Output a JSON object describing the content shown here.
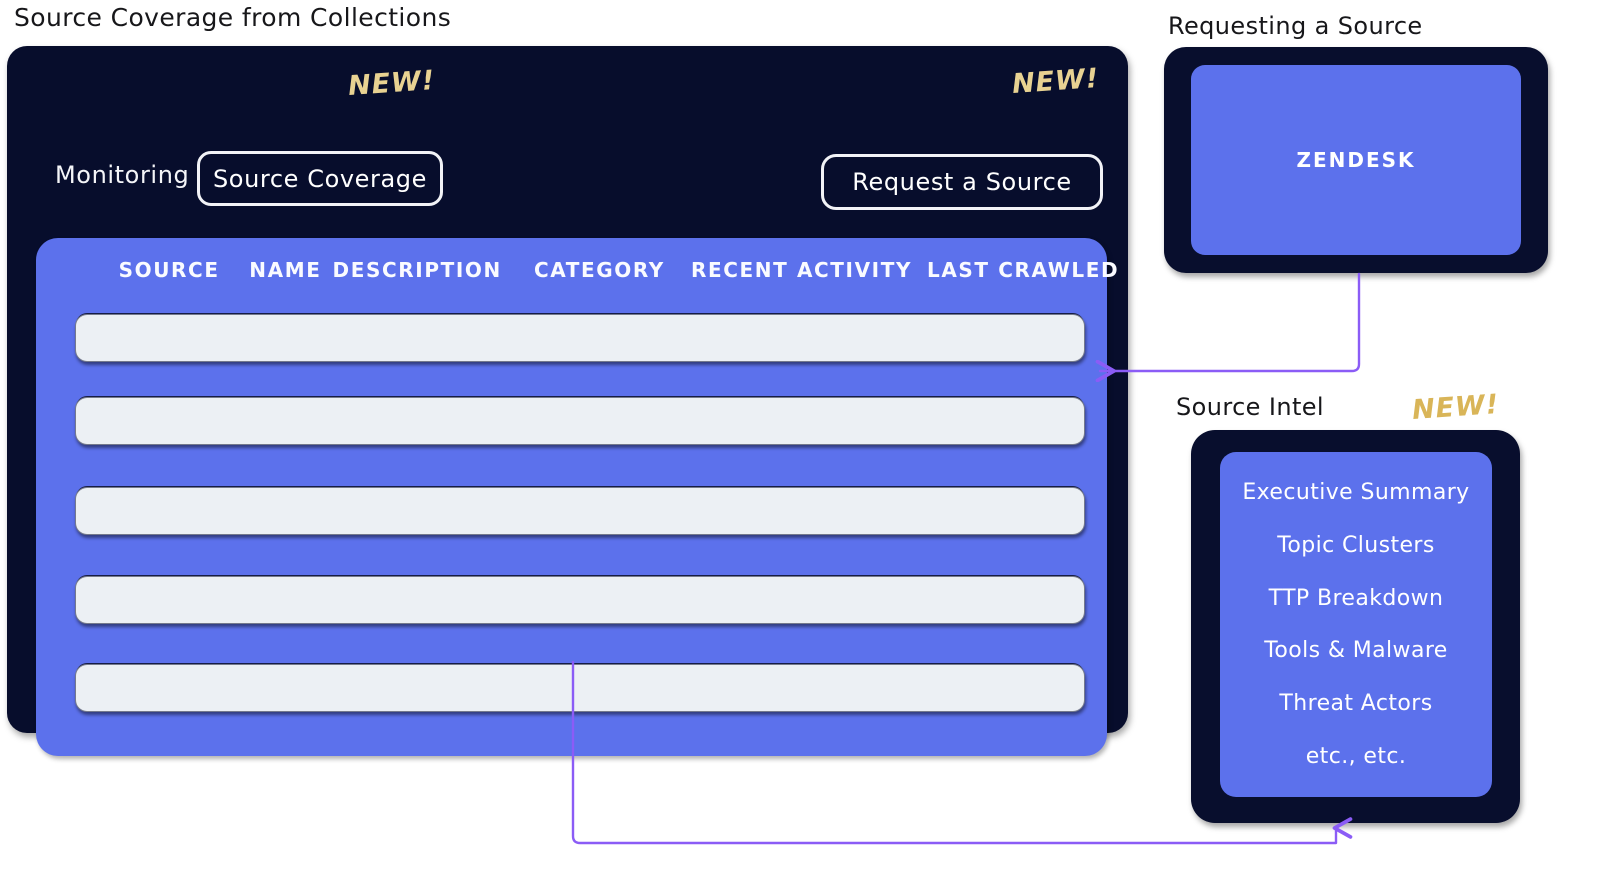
{
  "captions": {
    "coverage": "Source Coverage from Collections",
    "requesting": "Requesting a Source",
    "intel": "Source Intel"
  },
  "badges": {
    "new_tab": "NEW!",
    "new_request": "NEW!",
    "new_intel": "NEW!"
  },
  "main_app": {
    "nav_label": "Monitoring",
    "active_tab": "Source Coverage",
    "request_button": "Request a Source",
    "table": {
      "columns": [
        "SOURCE",
        "NAME",
        "DESCRIPTION",
        "CATEGORY",
        "RECENT ACTIVITY",
        "LAST CRAWLED"
      ],
      "row_count": 5,
      "rows": [
        "",
        "",
        "",
        "",
        ""
      ]
    }
  },
  "zendesk_card": {
    "label": "ZENDESK"
  },
  "source_intel_card": {
    "items": [
      "Executive Summary",
      "Topic Clusters",
      "TTP Breakdown",
      "Tools & Malware",
      "Threat Actors",
      "etc., etc."
    ]
  },
  "colors": {
    "frame_navy": "#080e2d",
    "panel_blue": "#5c71ec",
    "row_gray": "#ecf0f4",
    "badge_gold_on_dark": "#e8d292",
    "badge_gold_on_light": "#d9b558",
    "connector_purple": "#8b5cf6",
    "text_white": "#ffffff",
    "text_black": "#17171a",
    "background": "#ffffff"
  }
}
